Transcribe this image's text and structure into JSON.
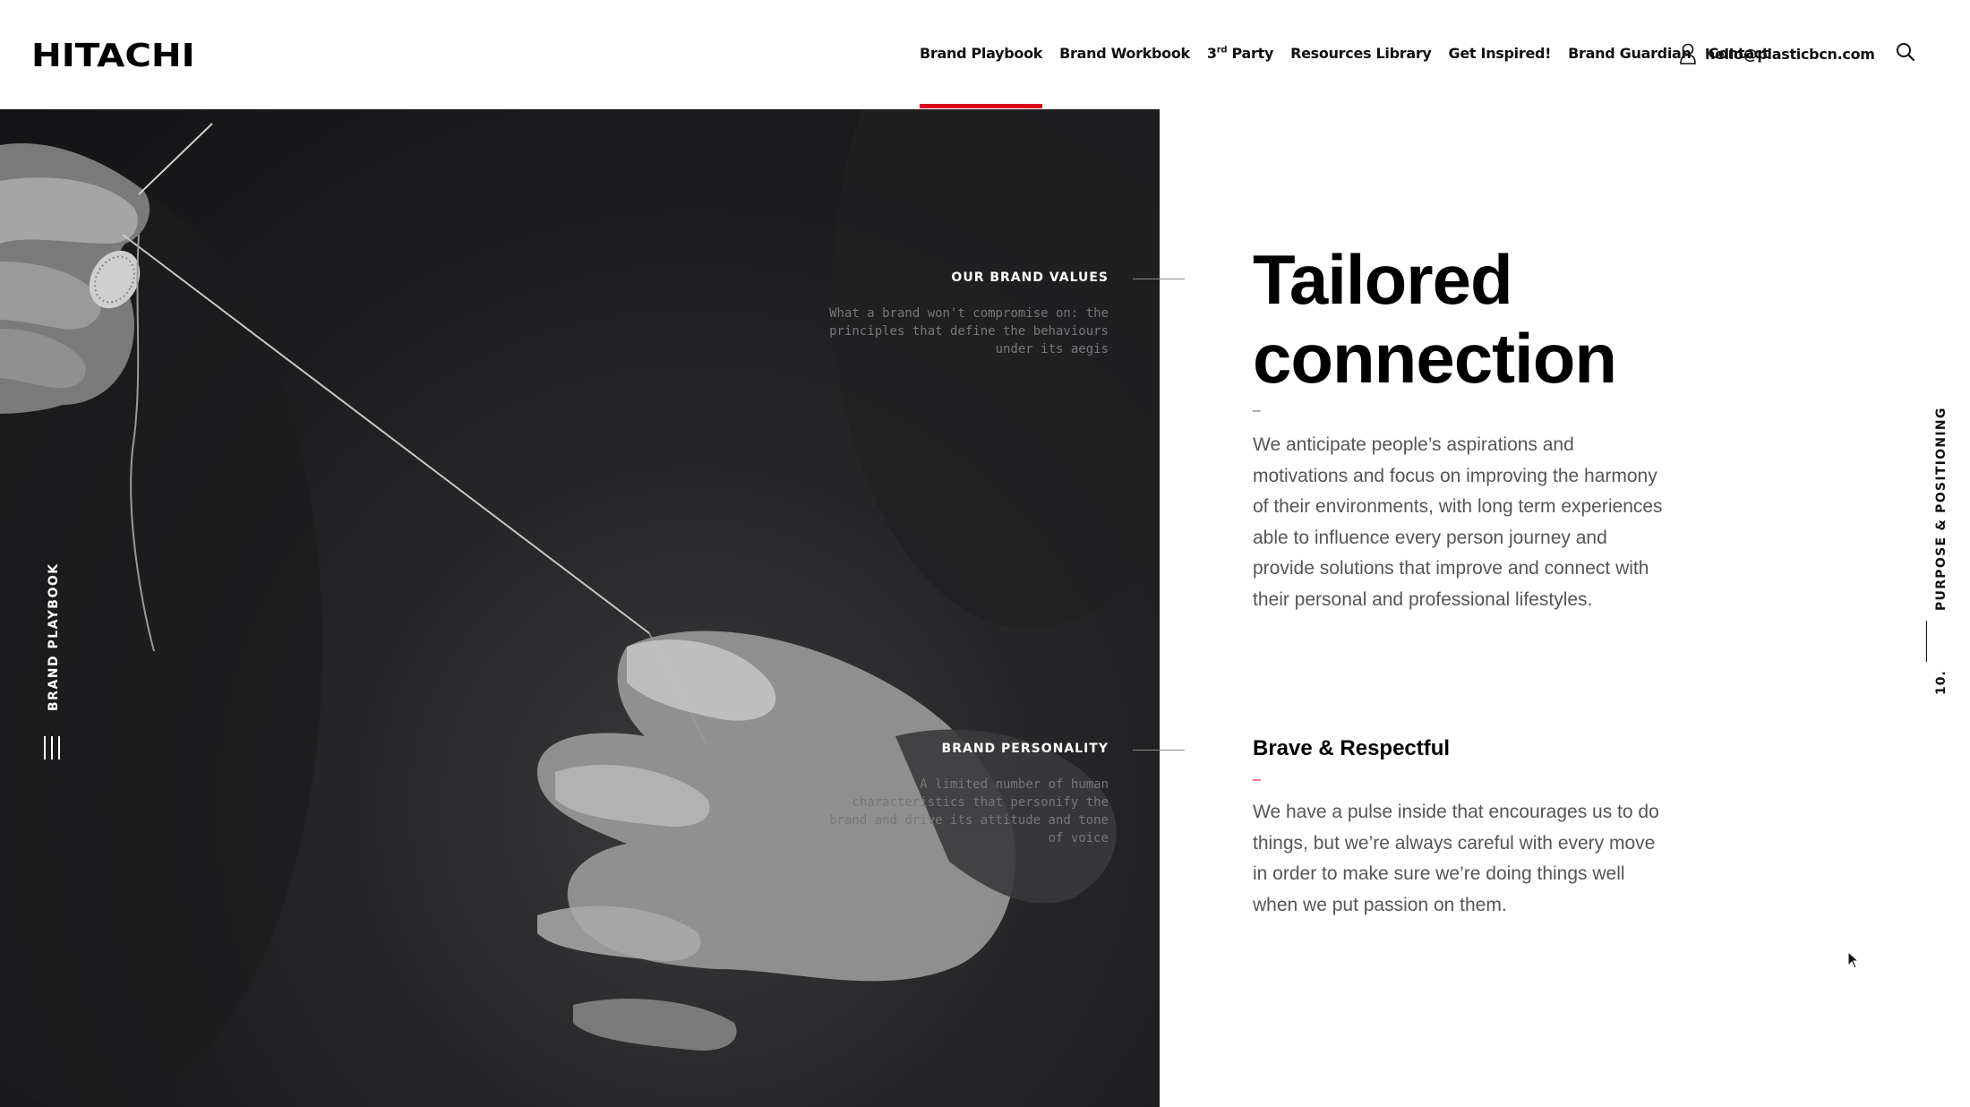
{
  "brand": {
    "logo": "HITACHI"
  },
  "nav": {
    "items": [
      {
        "label": "Brand Playbook",
        "active": true
      },
      {
        "label": "Brand Workbook"
      },
      {
        "label_main": "3",
        "label_sup": "rd",
        "label_rest": " Party"
      },
      {
        "label": "Resources Library"
      },
      {
        "label": "Get Inspired!"
      },
      {
        "label": "Brand Guardian"
      },
      {
        "label": "Contact"
      }
    ],
    "user_email": "hello@plasticbcn.com",
    "icons": {
      "user": "user-icon",
      "search": "search-icon"
    },
    "accent_color": "#d9001b"
  },
  "hero": {
    "side_label": "BRAND PLAYBOOK",
    "annotations": [
      {
        "title": "OUR BRAND VALUES",
        "desc": "What a brand won't compromise on: the principles that define the behaviours under its aegis"
      },
      {
        "title": "BRAND PERSONALITY",
        "desc": "A limited number of human characteristics that personify the brand and drive its attitude and tone of voice"
      }
    ]
  },
  "main": {
    "headline_line1": "Tailored",
    "headline_line2": "connection",
    "dash": "–",
    "intro": "We anticipate people’s aspirations and motivations and focus on improving the harmony of their environments, with long term experiences able to influence every person journey and provide solutions that improve and connect with their personal and professional lifestyles.",
    "sub_title": "Brave & Respectful",
    "sub_text": "We have a pulse inside that encourages us to do things, but we’re always careful with every move in order to make sure we’re doing things well when we put passion on them."
  },
  "section": {
    "label": "PURPOSE & POSITIONING",
    "number": "10."
  }
}
